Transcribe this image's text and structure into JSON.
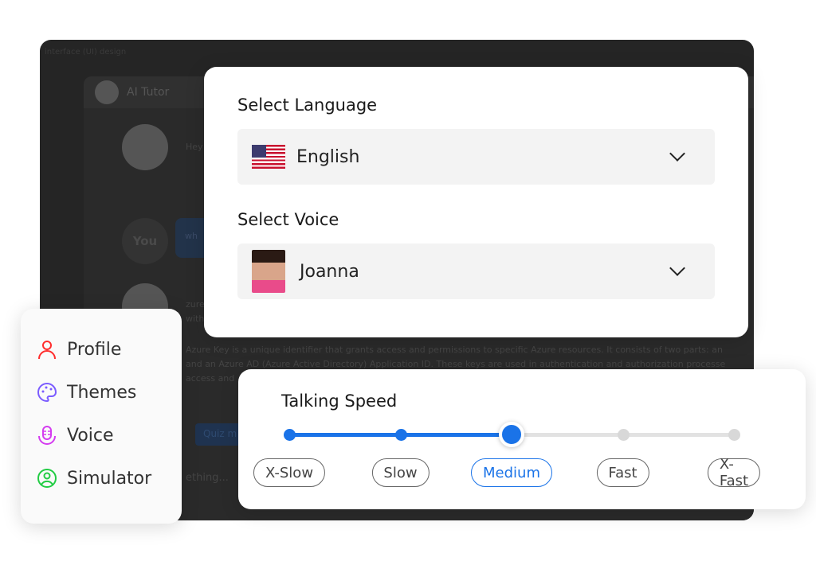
{
  "background": {
    "crumb": "interface (UI) design",
    "chat_title": "AI Tutor",
    "greeting": "Hey",
    "you_label": "You",
    "user_msg": "wh",
    "reply_1": "zure",
    "reply_2": "with",
    "paragraph": "Azure Key is a unique identifier that grants access and permissions to specific Azure resources. It consists of two parts: an",
    "paragraph_2": "and an Azure AD (Azure Active Directory) Application ID. These keys are used in authentication and authorization processe",
    "paragraph_3": "access and",
    "quiz": "Quiz m",
    "input_placeholder": "ething..."
  },
  "language": {
    "label": "Select Language",
    "value": "English",
    "flag": "us-flag"
  },
  "voice": {
    "label": "Select Voice",
    "value": "Joanna"
  },
  "menu": {
    "items": [
      {
        "label": "Profile",
        "icon": "user-icon",
        "color": "#ff2d2d"
      },
      {
        "label": "Themes",
        "icon": "palette-icon",
        "color": "#7b5cff"
      },
      {
        "label": "Voice",
        "icon": "microphone-icon",
        "color": "#d43cf0"
      },
      {
        "label": "Simulator",
        "icon": "user-circle-icon",
        "color": "#22cc44"
      }
    ]
  },
  "speed": {
    "label": "Talking Speed",
    "options": [
      "X-Slow",
      "Slow",
      "Medium",
      "Fast",
      "X-Fast"
    ],
    "selected_index": 2,
    "accent": "#1a73e8"
  }
}
